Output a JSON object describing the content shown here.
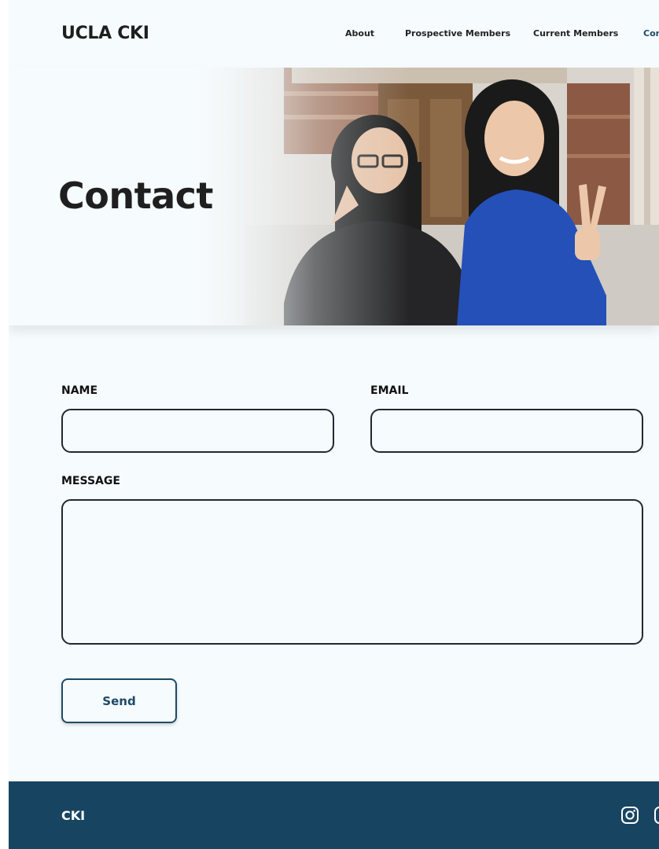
{
  "header": {
    "brand": "UCLA CKI",
    "nav": [
      {
        "label": "About",
        "active": false
      },
      {
        "label": "Prospective Members",
        "active": false
      },
      {
        "label": "Current Members",
        "active": false
      },
      {
        "label": "Contact",
        "active": true
      }
    ]
  },
  "hero": {
    "title": "Contact"
  },
  "form": {
    "name_label": "NAME",
    "name_value": "",
    "email_label": "EMAIL",
    "email_value": "",
    "message_label": "MESSAGE",
    "message_value": "",
    "send_label": "Send"
  },
  "footer": {
    "brand": "CKI",
    "social_icons": [
      "instagram-icon",
      "facebook-icon"
    ]
  },
  "colors": {
    "page_bg": "#f6fbfd",
    "accent": "#1e4a66",
    "footer_bg": "#174561",
    "text": "#1f1f1f"
  }
}
